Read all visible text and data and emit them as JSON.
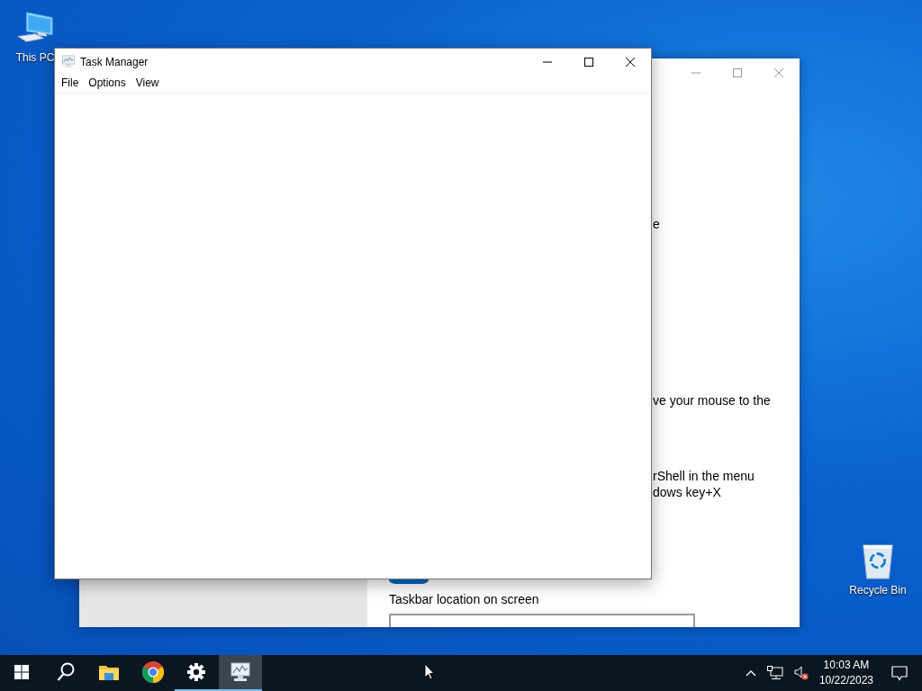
{
  "desktop": {
    "icons": [
      {
        "kind": "computer",
        "label": "This PC"
      },
      {
        "kind": "recycle",
        "label": "Recycle Bin"
      }
    ]
  },
  "settings_window": {
    "text_fragments": [
      "e",
      "ve your mouse to the",
      "rShell in the menu",
      "dows key+X"
    ],
    "toggle": {
      "on": true
    },
    "section_label": "Taskbar location on screen"
  },
  "task_manager": {
    "title": "Task Manager",
    "menu": [
      "File",
      "Options",
      "View"
    ]
  },
  "taskbar": {
    "items": [
      {
        "kind": "start",
        "running": false,
        "selected": false
      },
      {
        "kind": "search",
        "running": false,
        "selected": false
      },
      {
        "kind": "explorer",
        "running": false,
        "selected": false
      },
      {
        "kind": "chrome",
        "running": false,
        "selected": false
      },
      {
        "kind": "settings",
        "running": true,
        "selected": false
      },
      {
        "kind": "taskmanager",
        "running": true,
        "selected": true
      }
    ],
    "tray": {
      "time": "10:03 AM",
      "date": "10/22/2023"
    }
  }
}
